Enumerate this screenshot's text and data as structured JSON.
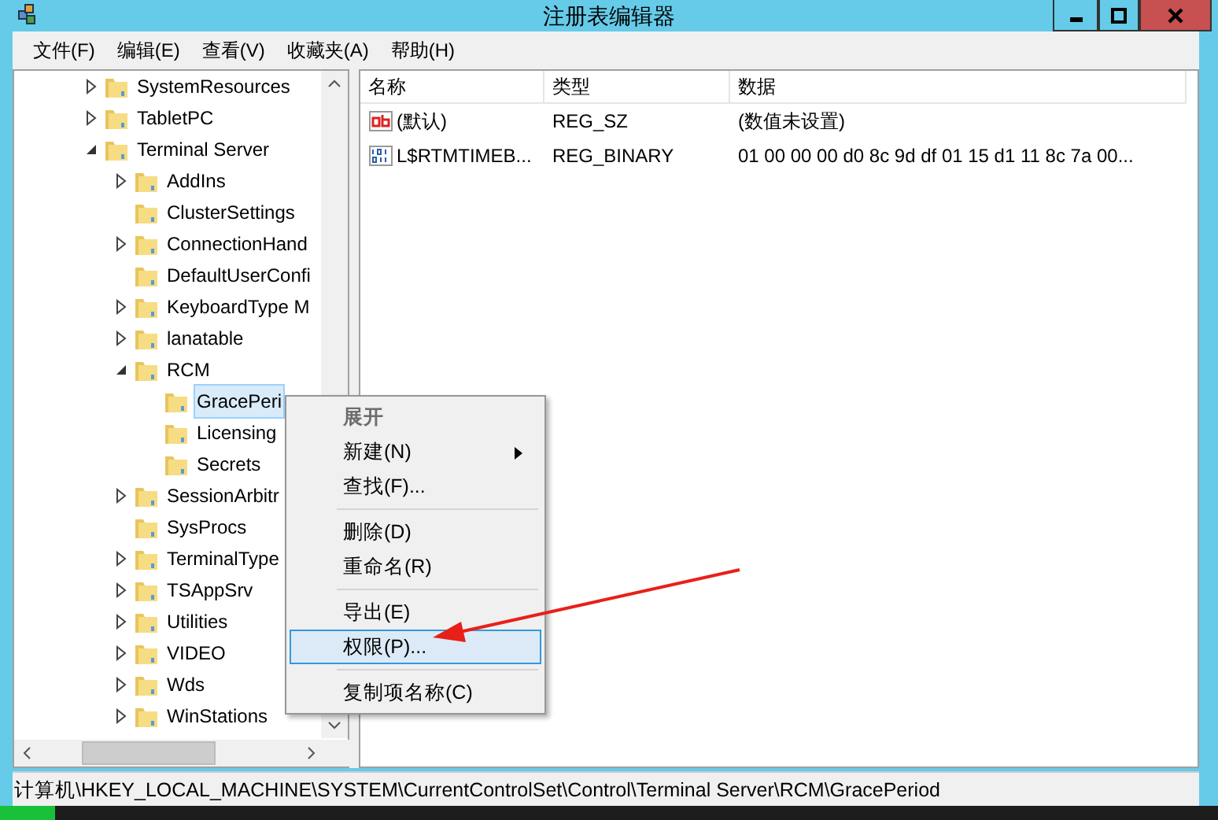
{
  "window": {
    "title": "注册表编辑器"
  },
  "menu_bar": [
    "文件(F)",
    "编辑(E)",
    "查看(V)",
    "收藏夹(A)",
    "帮助(H)"
  ],
  "tree": [
    {
      "name": "SystemResources",
      "expandable": true,
      "expanded": false,
      "selected": false
    },
    {
      "name": "TabletPC",
      "expandable": true,
      "expanded": false,
      "selected": false
    },
    {
      "name": "Terminal Server",
      "expandable": true,
      "expanded": true,
      "selected": false,
      "children": [
        {
          "name": "AddIns",
          "expandable": true,
          "expanded": false,
          "selected": false
        },
        {
          "name": "ClusterSettings",
          "expandable": false,
          "selected": false
        },
        {
          "name": "ConnectionHand",
          "expandable": true,
          "expanded": false,
          "selected": false
        },
        {
          "name": "DefaultUserConfi",
          "expandable": false,
          "selected": false
        },
        {
          "name": "KeyboardType M",
          "expandable": true,
          "expanded": false,
          "selected": false
        },
        {
          "name": "lanatable",
          "expandable": true,
          "expanded": false,
          "selected": false
        },
        {
          "name": "RCM",
          "expandable": true,
          "expanded": true,
          "selected": false,
          "children": [
            {
              "name": "GracePeri",
              "expandable": false,
              "selected": true
            },
            {
              "name": "Licensing",
              "expandable": false,
              "selected": false
            },
            {
              "name": "Secrets",
              "expandable": false,
              "selected": false
            }
          ]
        },
        {
          "name": "SessionArbitr",
          "expandable": true,
          "expanded": false,
          "selected": false
        },
        {
          "name": "SysProcs",
          "expandable": false,
          "selected": false
        },
        {
          "name": "TerminalType",
          "expandable": true,
          "expanded": false,
          "selected": false
        },
        {
          "name": "TSAppSrv",
          "expandable": true,
          "expanded": false,
          "selected": false
        },
        {
          "name": "Utilities",
          "expandable": true,
          "expanded": false,
          "selected": false
        },
        {
          "name": "VIDEO",
          "expandable": true,
          "expanded": false,
          "selected": false
        },
        {
          "name": "Wds",
          "expandable": true,
          "expanded": false,
          "selected": false
        },
        {
          "name": "WinStations",
          "expandable": true,
          "expanded": false,
          "selected": false
        }
      ]
    }
  ],
  "values_table": {
    "columns": [
      "名称",
      "类型",
      "数据"
    ],
    "rows": [
      {
        "kind": "string",
        "name": "(默认)",
        "type": "REG_SZ",
        "data": "(数值未设置)"
      },
      {
        "kind": "binary",
        "name": "L$RTMTIMEB...",
        "type": "REG_BINARY",
        "data": "01 00 00 00 d0 8c 9d df 01 15 d1 11 8c 7a 00..."
      }
    ]
  },
  "context_menu": [
    {
      "kind": "item",
      "label": "展开",
      "disabled": true,
      "default": true,
      "submenu": false,
      "selected": false
    },
    {
      "kind": "item",
      "label": "新建(N)",
      "disabled": false,
      "default": false,
      "submenu": true,
      "selected": false
    },
    {
      "kind": "item",
      "label": "查找(F)...",
      "disabled": false,
      "default": false,
      "submenu": false,
      "selected": false
    },
    {
      "kind": "separator"
    },
    {
      "kind": "item",
      "label": "删除(D)",
      "disabled": false,
      "default": false,
      "submenu": false,
      "selected": false
    },
    {
      "kind": "item",
      "label": "重命名(R)",
      "disabled": false,
      "default": false,
      "submenu": false,
      "selected": false
    },
    {
      "kind": "separator"
    },
    {
      "kind": "item",
      "label": "导出(E)",
      "disabled": false,
      "default": false,
      "submenu": false,
      "selected": false
    },
    {
      "kind": "item",
      "label": "权限(P)...",
      "disabled": false,
      "default": false,
      "submenu": false,
      "selected": true
    },
    {
      "kind": "separator"
    },
    {
      "kind": "item",
      "label": "复制项名称(C)",
      "disabled": false,
      "default": false,
      "submenu": false,
      "selected": false
    }
  ],
  "status_bar": "计算机\\HKEY_LOCAL_MACHINE\\SYSTEM\\CurrentControlSet\\Control\\Terminal Server\\RCM\\GracePeriod"
}
